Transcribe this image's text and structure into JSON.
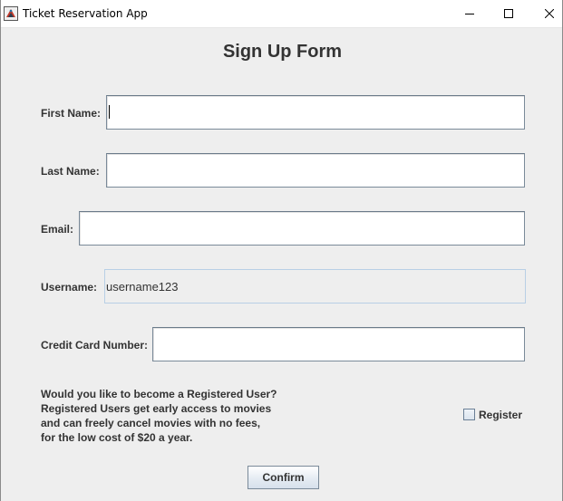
{
  "window": {
    "title": "Ticket Reservation App",
    "icons": {
      "app": "app-icon",
      "minimize": "minimize-icon",
      "maximize": "maximize-icon",
      "close": "close-icon"
    }
  },
  "form": {
    "title": "Sign Up Form",
    "first_name": {
      "label": "First Name:",
      "value": ""
    },
    "last_name": {
      "label": "Last Name:",
      "value": ""
    },
    "email": {
      "label": "Email:",
      "value": ""
    },
    "username": {
      "label": "Username:",
      "value": "username123"
    },
    "credit_card": {
      "label": "Credit Card Number:",
      "value": ""
    }
  },
  "registration": {
    "info_lines": [
      "Would you like to become a Registered User?",
      "Registered Users get early access to movies",
      "and can freely cancel movies with no fees,",
      "for the low cost of $20 a year."
    ],
    "checkbox_label": "Register",
    "checked": false
  },
  "actions": {
    "confirm_label": "Confirm"
  },
  "colors": {
    "background": "#eeeeee",
    "text": "#333333",
    "field_border": "#7a8a99",
    "readonly_border": "#b8cfe5"
  }
}
